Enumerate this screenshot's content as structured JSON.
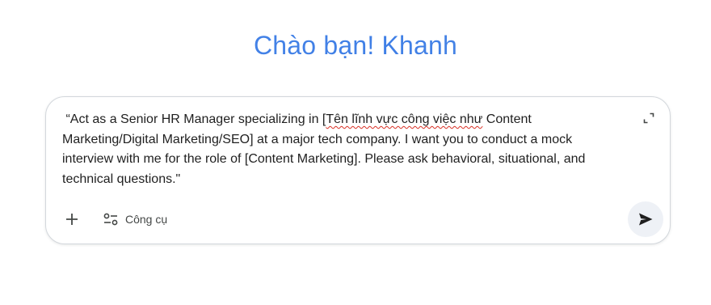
{
  "greeting": {
    "text": "Chào bạn! Khanh"
  },
  "composer": {
    "prompt_before": " “Act as a Senior HR Manager specializing in [",
    "prompt_misspelled": "Tên lĩnh vực công việc như",
    "prompt_after": " Content Marketing/Digital Marketing/SEO] at a major tech company. I want you to conduct a mock interview with me for the role of [Content Marketing]. Please ask behavioral, situational, and technical questions.\"",
    "tools_label": "Công cụ",
    "icons": {
      "expand": "expand-icon",
      "add": "plus-icon",
      "tools": "tools-sliders-icon",
      "send": "send-icon"
    }
  },
  "colors": {
    "greeting": "#4285f4",
    "text": "#1f1f1f",
    "border": "#d3d7dc",
    "send_bg": "#eef1f6",
    "spellcheck": "#d93025"
  }
}
